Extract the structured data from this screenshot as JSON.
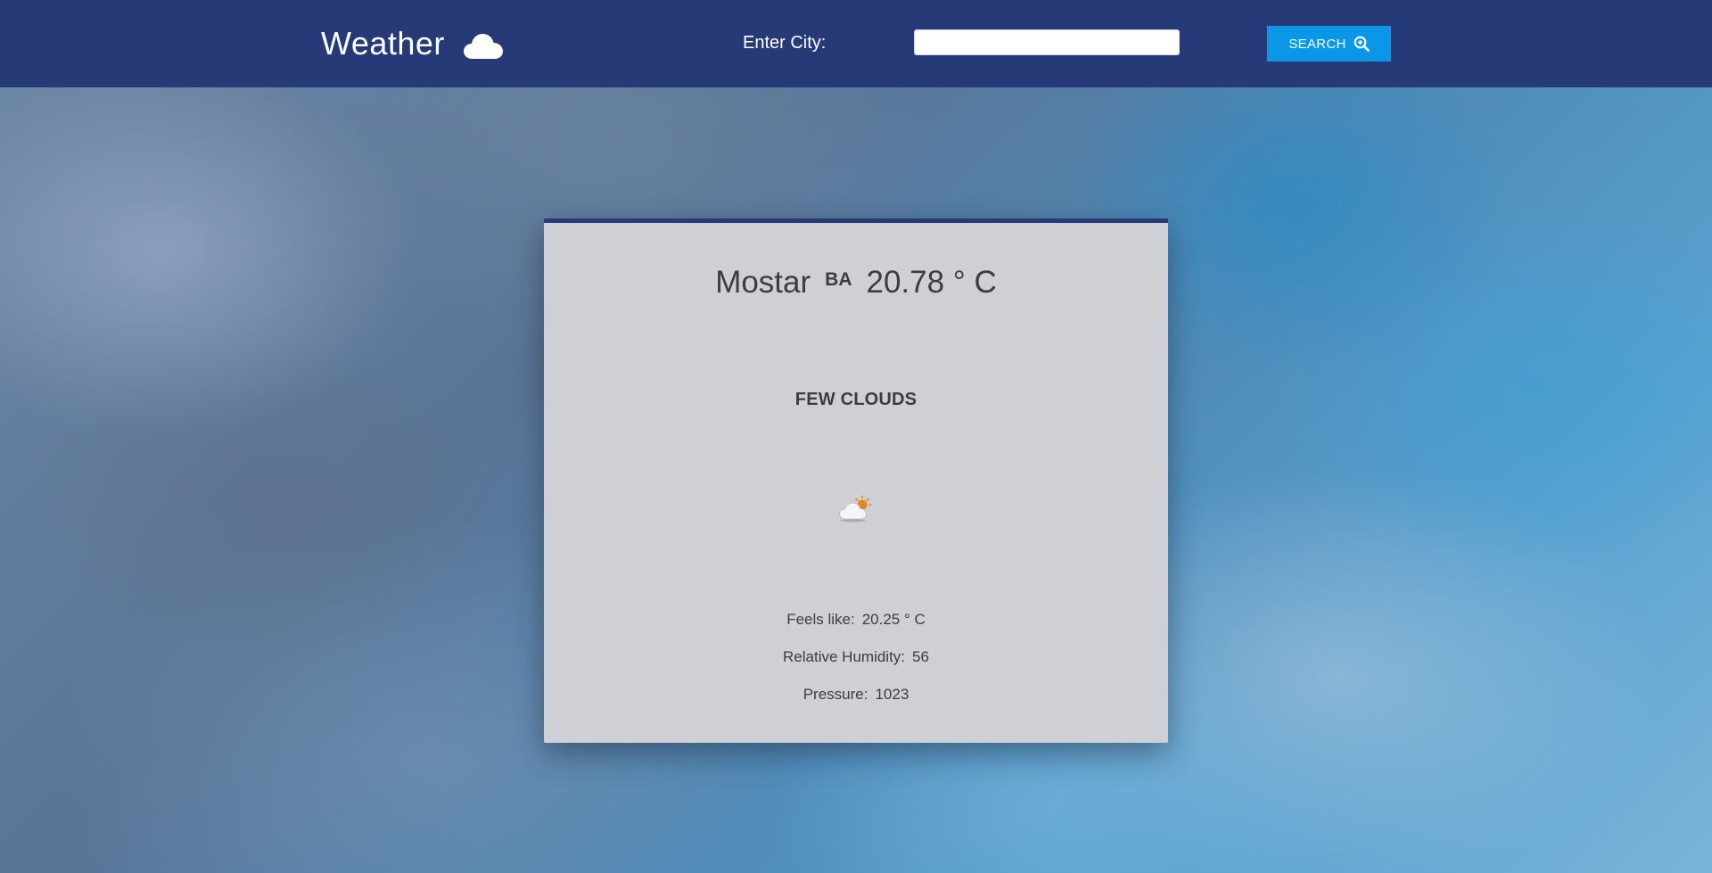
{
  "header": {
    "app_title": "Weather",
    "app_icon": "cloud-icon",
    "city_label": "Enter City:",
    "city_input": {
      "value": "",
      "placeholder": ""
    },
    "search_label": "SEARCH",
    "search_icon": "magnifier-plus-icon",
    "bar_color": "#263a77",
    "button_color": "#0a97e8"
  },
  "weather": {
    "city": "Mostar",
    "country": "BA",
    "temperature": "20.78 ° C",
    "description": "FEW CLOUDS",
    "icon": "few-clouds-icon",
    "details": [
      {
        "label": "Feels like:",
        "value": "20.25 ° C"
      },
      {
        "label": "Relative Humidity:",
        "value": "56"
      },
      {
        "label": "Pressure:",
        "value": "1023"
      }
    ]
  }
}
